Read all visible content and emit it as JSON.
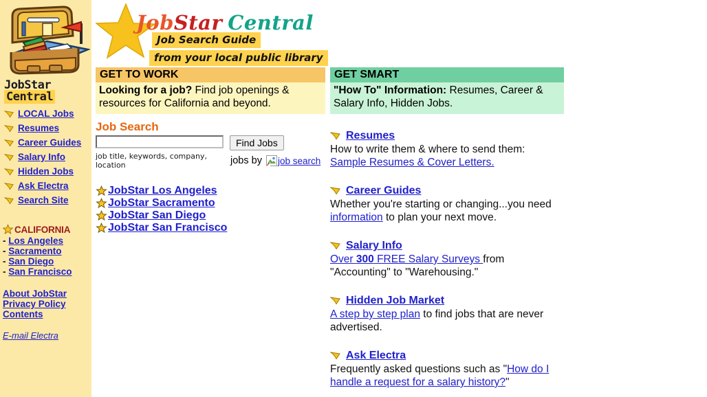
{
  "sidebar": {
    "logo_alt": "open-suitcase-desk-illustration",
    "title_line1": "JobStar",
    "title_line2": "Central",
    "nav_items": [
      {
        "label": "LOCAL Jobs",
        "icon": "chevron-bullet-icon"
      },
      {
        "label": "Resumes",
        "icon": "chevron-bullet-icon"
      },
      {
        "label": "Career Guides",
        "icon": "chevron-bullet-icon"
      },
      {
        "label": "Salary Info",
        "icon": "chevron-bullet-icon"
      },
      {
        "label": "Hidden Jobs",
        "icon": "chevron-bullet-icon"
      },
      {
        "label": "Ask Electra",
        "icon": "chevron-bullet-icon"
      },
      {
        "label": "Search Site",
        "icon": "chevron-bullet-icon"
      }
    ],
    "region_heading": "CALIFORNIA",
    "region_icon": "star-icon",
    "cities": [
      "Los Angeles",
      "Sacramento",
      "San Diego",
      "San Francisco"
    ],
    "city_prefix": "- ",
    "footer_links": [
      "About JobStar",
      "Privacy Policy",
      "Contents"
    ],
    "email_link": "E-mail Electra"
  },
  "banner": {
    "star_icon": "gold-star-icon",
    "logo_job": "Job",
    "logo_star": "Star",
    "logo_central": "Central",
    "tagline_1": "Job Search Guide",
    "tagline_2": "from your local public library"
  },
  "get_to_work": {
    "heading": "GET TO WORK",
    "lead_bold": "Looking for a job?",
    "lead_rest": " Find job openings & resources for California and beyond.",
    "search_title": "Job Search",
    "search_value": "",
    "search_placeholder": "",
    "search_hint": "job title, keywords, company, location",
    "find_button": "Find Jobs",
    "jobs_by_label": "jobs by",
    "jobs_by_image_alt": "job search",
    "jobs_by_image_icon": "broken-image-icon",
    "city_links": [
      "JobStar Los Angeles",
      "JobStar Sacramento",
      "JobStar San Diego",
      "JobStar San Francisco"
    ]
  },
  "get_smart": {
    "heading": "GET SMART",
    "lead_bold": "\"How To\" Information:",
    "lead_rest": " Resumes, Career & Salary Info, Hidden Jobs.",
    "topics": [
      {
        "title": "Resumes",
        "icon": "chevron-bullet-icon",
        "text_before": "How to write them & where to send them: ",
        "link_text": "Sample Resumes & Cover Letters.",
        "text_after": ""
      },
      {
        "title": "Career Guides",
        "icon": "chevron-bullet-icon",
        "text_before": "Whether you're starting or changing...you need ",
        "link_text": "information",
        "text_after": " to plan your next move."
      },
      {
        "title": "Salary Info",
        "icon": "chevron-bullet-icon",
        "link_lead": "Over ",
        "link_bold": "300",
        "link_tail": " FREE Salary Surveys ",
        "text_after": "from \"Accounting\" to \"Warehousing.\""
      },
      {
        "title": "Hidden Job Market",
        "icon": "chevron-bullet-icon",
        "link_text": "A step by step plan",
        "text_after": " to find jobs that are never advertised."
      },
      {
        "title": "Ask Electra",
        "icon": "chevron-bullet-icon",
        "text_before": "Frequently asked questions such as \"",
        "link_text": "How do I handle a request for a salary history?",
        "text_after": "\""
      }
    ]
  },
  "colors": {
    "sidebar_bg": "#FCE9A8",
    "work_head": "#F6C566",
    "work_body": "#FDF5BE",
    "smart_head": "#6FCFA0",
    "smart_body": "#C9F3D6",
    "link": "#2020CC",
    "accent_orange": "#E8660F",
    "accent_red": "#9E1B1B",
    "highlight_yellow": "#FFD24D"
  }
}
